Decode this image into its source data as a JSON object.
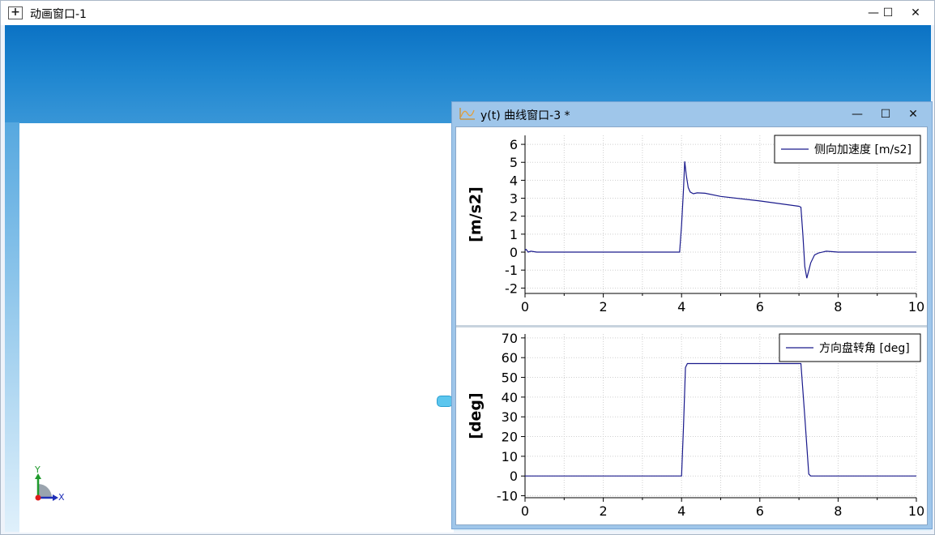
{
  "main_window": {
    "title": "动画窗口-1",
    "minimize": "—",
    "maximize": "☐",
    "close": "✕"
  },
  "axes_gizmo": {
    "y_label": "Y",
    "x_label": "X"
  },
  "plot_window": {
    "title": "y(t) 曲线窗口-3 *",
    "minimize": "—",
    "maximize": "☐",
    "close": "✕"
  },
  "chart_data": [
    {
      "type": "line",
      "ylabel": "[m/s2]",
      "xlim": [
        0,
        10
      ],
      "ylim": [
        -2.3,
        6.5
      ],
      "xticks": [
        "0",
        "2",
        "4",
        "6",
        "8",
        "10"
      ],
      "yticks": [
        "-2",
        "-1",
        "0",
        "1",
        "2",
        "3",
        "4",
        "5",
        "6"
      ],
      "grid": true,
      "legend_position": "top-right",
      "color": "#1a1a8c",
      "series": [
        {
          "name": "侧向加速度 [m/s2]",
          "x": [
            0,
            0.03,
            0.08,
            0.15,
            0.3,
            1,
            2,
            3,
            3.95,
            4.0,
            4.05,
            4.08,
            4.12,
            4.17,
            4.22,
            4.3,
            4.4,
            4.6,
            5,
            6,
            7,
            7.05,
            7.1,
            7.15,
            7.2,
            7.3,
            7.4,
            7.5,
            7.7,
            8,
            9,
            10
          ],
          "y": [
            0.1,
            0.15,
            0,
            0.05,
            0,
            0,
            0,
            0,
            0,
            1.5,
            3.5,
            5.05,
            4.3,
            3.6,
            3.35,
            3.25,
            3.3,
            3.28,
            3.1,
            2.85,
            2.55,
            2.5,
            1.0,
            -0.8,
            -1.45,
            -0.6,
            -0.15,
            -0.05,
            0.05,
            0,
            0,
            0
          ]
        }
      ]
    },
    {
      "type": "line",
      "ylabel": "[deg]",
      "xlim": [
        0,
        10
      ],
      "ylim": [
        -11,
        72
      ],
      "xticks": [
        "0",
        "2",
        "4",
        "6",
        "8",
        "10"
      ],
      "yticks": [
        "-10",
        "0",
        "10",
        "20",
        "30",
        "40",
        "50",
        "60",
        "70"
      ],
      "grid": true,
      "legend_position": "top-right",
      "color": "#1a1a8c",
      "series": [
        {
          "name": "方向盘转角 [deg]",
          "x": [
            0,
            1,
            2,
            3,
            4.0,
            4.05,
            4.1,
            4.15,
            5,
            6,
            7.05,
            7.15,
            7.25,
            7.3,
            8,
            9,
            10
          ],
          "y": [
            0,
            0,
            0,
            0,
            0,
            25,
            55,
            57,
            57,
            57,
            57,
            30,
            1,
            0,
            0,
            0,
            0
          ]
        }
      ]
    }
  ]
}
